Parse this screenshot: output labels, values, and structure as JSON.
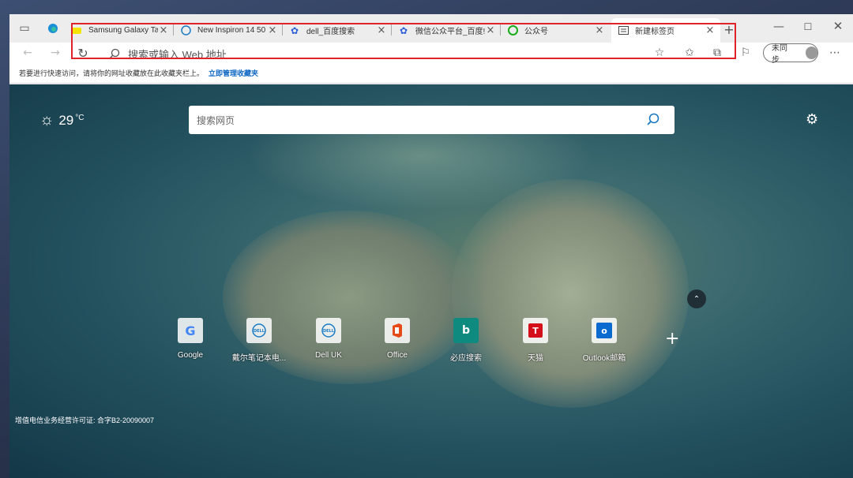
{
  "tabs": [
    {
      "title": "Samsung Galaxy Tal",
      "icon": "samsung-favicon"
    },
    {
      "title": "New Inspiron 14 50",
      "icon": "dell-favicon"
    },
    {
      "title": "dell_百度搜索",
      "icon": "baidu-favicon"
    },
    {
      "title": "微信公众平台_百度!",
      "icon": "baidu-favicon"
    },
    {
      "title": "公众号",
      "icon": "wechat-favicon"
    },
    {
      "title": "新建标签页",
      "icon": "newtab-favicon"
    }
  ],
  "toolbar": {
    "address_placeholder": "搜索或输入 Web 地址",
    "sync_label": "未同步"
  },
  "bookmarks_bar": {
    "hint": "若要进行快速访问，请将你的网址收藏放在此收藏夹栏上。",
    "link": "立即管理收藏夹"
  },
  "newtab": {
    "temperature": "29",
    "unit": "°C",
    "search_placeholder": "搜索网页",
    "quick_links": [
      {
        "label": "Google",
        "icon": "google-icon"
      },
      {
        "label": "戴尔笔记本电...",
        "icon": "dell-icon"
      },
      {
        "label": "Dell UK",
        "icon": "dell-icon"
      },
      {
        "label": "Office",
        "icon": "office-icon"
      },
      {
        "label": "必应搜索",
        "icon": "bing-icon"
      },
      {
        "label": "天猫",
        "icon": "tmall-icon"
      },
      {
        "label": "Outlook邮箱",
        "icon": "outlook-icon"
      }
    ],
    "license": "增值电信业务经营许可证: 合字B2-20090007"
  },
  "colors": {
    "highlight": "#e0232a",
    "link": "#0a66c2"
  }
}
